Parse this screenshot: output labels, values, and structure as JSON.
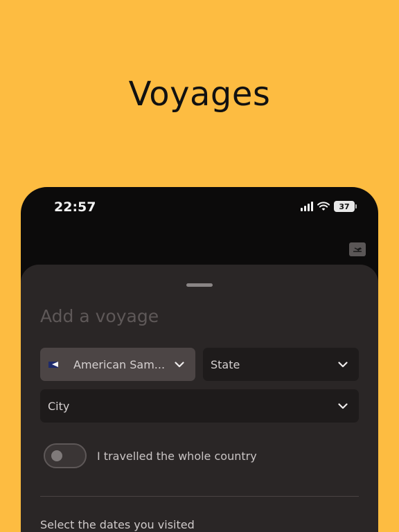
{
  "promo": {
    "title": "Voyages"
  },
  "status_bar": {
    "time": "22:57",
    "battery": "37"
  },
  "sheet": {
    "title": "Add a voyage",
    "country": {
      "value": "American Sam...",
      "flag": "american-samoa-flag-icon"
    },
    "state": {
      "value": "State"
    },
    "city": {
      "value": "City"
    },
    "toggle": {
      "label": "I travelled the whole country",
      "checked": false
    },
    "dates_label": "Select the dates you visited"
  },
  "colors": {
    "background": "#FDBC41",
    "phone": "#0c0b0b",
    "sheet": "#2a2626",
    "field": "#1e1b1b",
    "field_selected": "#4c4545"
  }
}
